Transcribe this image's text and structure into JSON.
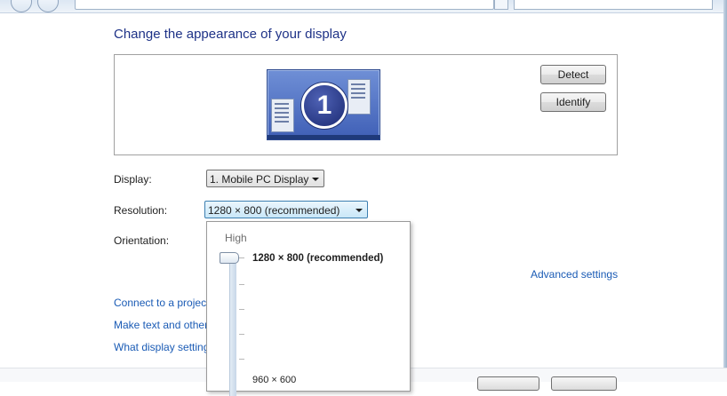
{
  "page_title": "Change the appearance of your display",
  "buttons": {
    "detect": "Detect",
    "identify": "Identify"
  },
  "monitor": {
    "number": "1"
  },
  "display": {
    "label": "Display:",
    "value": "1. Mobile PC Display"
  },
  "resolution": {
    "label": "Resolution:",
    "value": "1280 × 800 (recommended)",
    "slider": {
      "high_label": "High",
      "current_option": "1280 × 800 (recommended)",
      "low_option_partial": "960 × 600"
    }
  },
  "orientation": {
    "label": "Orientation:"
  },
  "links": {
    "advanced": "Advanced settings",
    "projector": "Connect to a projec",
    "text_size": "Make text and other",
    "what_settings": "What display setting"
  },
  "colors": {
    "title": "#1e3287",
    "link": "#1a5bb5"
  }
}
